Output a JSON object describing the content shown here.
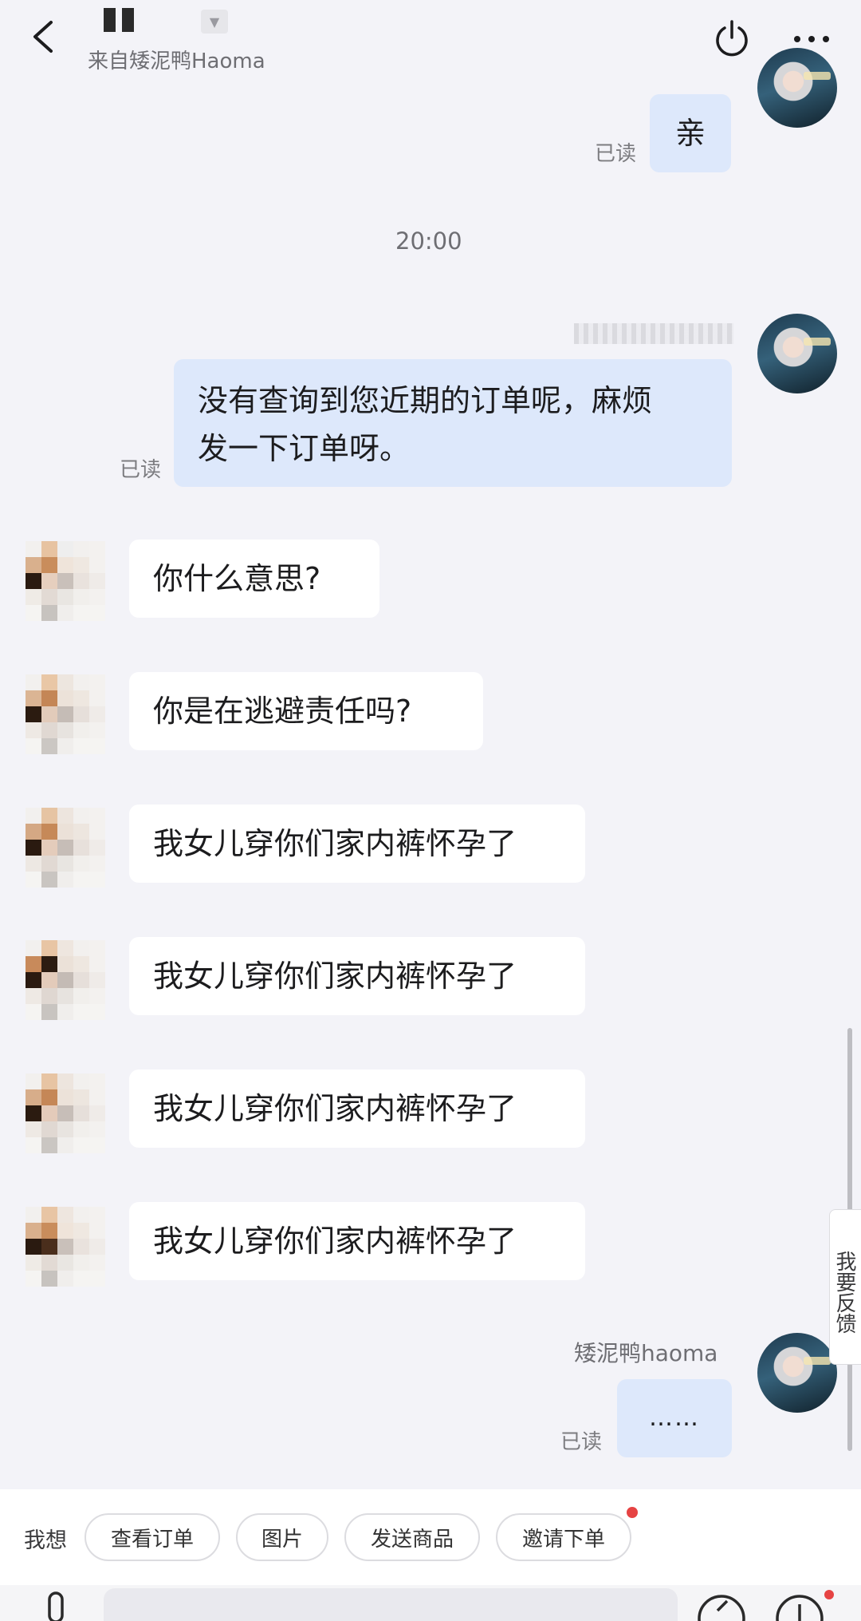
{
  "header": {
    "source_label": "来自矮泥鸭Haoma",
    "back_icon": "chevron-left-icon",
    "power_icon": "power-icon",
    "more_label": "···"
  },
  "messages": [
    {
      "side": "out",
      "text": "亲",
      "status": "已读"
    },
    {
      "type": "time",
      "text": "20:00"
    },
    {
      "side": "out",
      "text_lines": [
        "没有查询到您近期的订单呢，麻烦",
        "发一下订单呀。"
      ],
      "status": "已读"
    },
    {
      "side": "in",
      "text": "你什么意思?"
    },
    {
      "side": "in",
      "text": "你是在逃避责任吗?"
    },
    {
      "side": "in",
      "text": "我女儿穿你们家内裤怀孕了"
    },
    {
      "side": "in",
      "text": "我女儿穿你们家内裤怀孕了"
    },
    {
      "side": "in",
      "text": "我女儿穿你们家内裤怀孕了"
    },
    {
      "side": "in",
      "text": "我女儿穿你们家内裤怀孕了"
    },
    {
      "side": "out",
      "sender": "矮泥鸭haoma",
      "text": "……",
      "status": "已读"
    }
  ],
  "feedback_tab": "我要反馈",
  "quick_bar": {
    "prefix": "我想",
    "chips": [
      "查看订单",
      "图片",
      "发送商品",
      "邀请下单"
    ]
  },
  "colors": {
    "outgoing_bubble": "#dde8fb",
    "incoming_bubble": "#ffffff",
    "background": "#f3f3f8",
    "badge_red": "#e64343"
  }
}
